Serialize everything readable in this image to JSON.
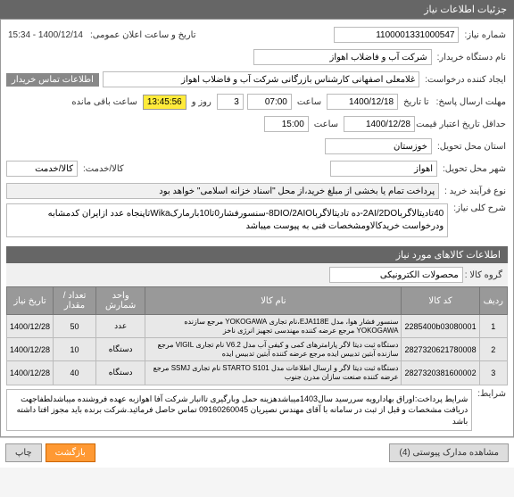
{
  "header": "جزئیات اطلاعات نیاز",
  "fields": {
    "need_number_label": "شماره نیاز:",
    "need_number": "1100001331000547",
    "announce_label": "تاریخ و ساعت اعلان عمومی:",
    "announce_value": "1400/12/14 - 15:34",
    "buyer_label": "نام دستگاه خریدار:",
    "buyer_value": "شرکت آب و فاضلاب اهواز",
    "creator_label": "ایجاد کننده درخواست:",
    "creator_value": "غلامعلی اصفهانی کارشناس بازرگانی شرکت آب و فاضلاب اهواز",
    "contact_btn": "اطلاعات تماس خریدار",
    "send_deadline_label": "مهلت ارسال پاسخ:",
    "send_deadline_date_label": "تا تاریخ",
    "send_deadline_date": "1400/12/18",
    "send_deadline_time_label": "ساعت",
    "send_deadline_time": "07:00",
    "days_label": "روز و",
    "days_value": "3",
    "remaining_label": "ساعت باقی مانده",
    "remaining_time": "13:45:56",
    "validity_label": "حداقل تاریخ اعتبار قیمت تا تاریخ:",
    "validity_date": "1400/12/28",
    "validity_time_label": "ساعت",
    "validity_time": "15:00",
    "province_label": "استان محل تحویل:",
    "province_value": "خوزستان",
    "city_label": "شهر محل تحویل:",
    "city_value": "اهواز",
    "service_label": "کالا/خدمت:",
    "service_value": "کالا/خدمت",
    "process_label": "نوع فرآیند خرید :",
    "process_value": " پرداخت تمام یا بخشی از مبلغ خرید،از محل \"اسناد خزانه اسلامی\" خواهد بود ",
    "desc_label": "شرح کلی نیاز:",
    "desc_value": "40تادیتالاگربا2AI/2DO-ده تادیتالاگربا8DIO/2AIO-سنسورفشار0تا10بارمارکWikaتاپنجاه عدد ازایران کدمشابه ودرخواست خریدکالاومشخصات فنی به پیوست میباشد",
    "conditions_label": "شرایط:",
    "conditions_value": "شرایط پرداخت:اوراق بهادارویه سررسید سال1403میباشدهزینه حمل وبارگیری تاانبار شرکت آفا اهوازبه عهده فروشنده میباشدلطفاجهت دریافت مشخصات و قبل از ثبت در سامانه با آقای مهندس نصیریان 09160260045 تماس حاصل فرمائید.شرکت برنده باید مجوز افتا داشته باشد"
  },
  "items_header": "اطلاعات کالاهای مورد نیاز",
  "group_label": "گروه کالا :",
  "group_value": "محصولات الکترونیکی",
  "table": {
    "headers": [
      "ردیف",
      "کد کالا",
      "نام کالا",
      "واحد شمارش",
      "تعداد / مقدار",
      "تاریخ نیاز"
    ],
    "rows": [
      {
        "idx": "1",
        "code": "2285400b03080001",
        "name": "سنسور فشار هوا، مدل EJA118E،نام تجاری YOKOGAWA مرجع سازنده YOKOGAWA مرجع عرضه کننده مهندسی تجهیز انرژی ناخز",
        "unit": "عدد",
        "qty": "50",
        "date": "1400/12/28"
      },
      {
        "idx": "2",
        "code": "2827320621780008",
        "name": "دستگاه ثبت دیتا لاگر پارامترهای کمی و کیفی آب مدل V6.2 نام تجاری VIGIL مرجع سازنده آبتین تدبیس ایده مرجع عرضه کننده آبتین تدبیس ایده",
        "unit": "دستگاه",
        "qty": "10",
        "date": "1400/12/28"
      },
      {
        "idx": "3",
        "code": "2827320381600002",
        "name": "دستگاه ثبت دیتا لاگر و ارسال اطلاعات مدل STARTO S101 نام تجاری SSMJ مرجع عرضه کننده صنعت سازان مدرن جنوب",
        "unit": "دستگاه",
        "qty": "40",
        "date": "1400/12/28"
      }
    ]
  },
  "footer": {
    "attachments_btn": "مشاهده مدارک پیوستی (4)",
    "back_btn": "بازگشت",
    "print_btn": "چاپ"
  }
}
